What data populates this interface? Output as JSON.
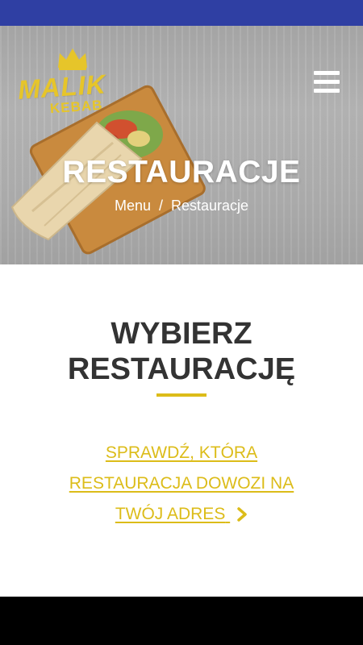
{
  "brand": {
    "name": "MALIK",
    "sub": "KEBAB",
    "color": "#e6c52a"
  },
  "colors": {
    "status_bar": "#2f3fa3",
    "accent": "#dcbc19",
    "heading": "#333333",
    "hero_text": "#ffffff"
  },
  "hero": {
    "title": "RESTAURACJE",
    "breadcrumb": {
      "home": "Menu",
      "separator": "/",
      "current": "Restauracje"
    }
  },
  "menu": {
    "icon": "hamburger-menu-icon"
  },
  "section": {
    "title_line1": "WYBIERZ",
    "title_line2": "RESTAURACJĘ",
    "link_line1": "SPRAWDŹ, KTÓRA",
    "link_line2": "RESTAURACJA DOWOZI NA",
    "link_line3": "TWÓJ ADRES",
    "link_icon": "chevron-right-icon"
  }
}
